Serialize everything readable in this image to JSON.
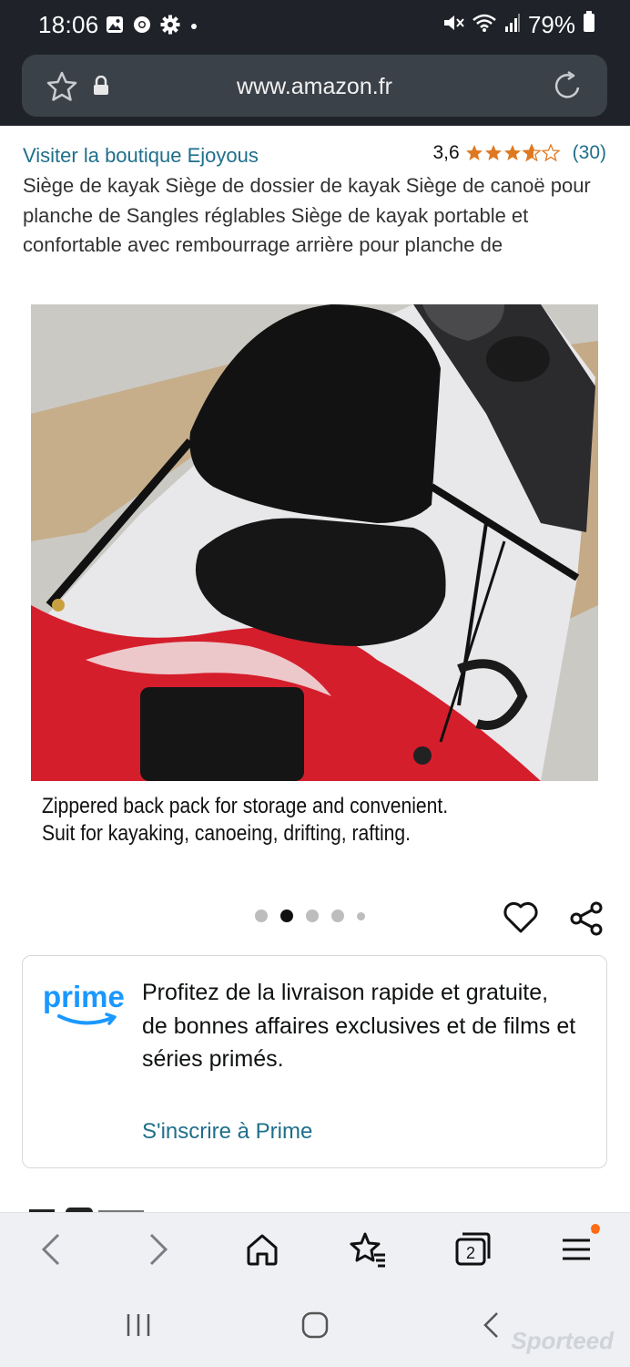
{
  "status_bar": {
    "time": "18:06",
    "battery": "79%",
    "icons": [
      "gallery-icon",
      "chrome-icon",
      "settings-icon",
      "dot-icon",
      "mute-icon",
      "wifi-icon",
      "signal-icon",
      "battery-icon"
    ]
  },
  "browser": {
    "url": "www.amazon.fr",
    "icons": [
      "bookmark-star-icon",
      "lock-icon",
      "reload-icon"
    ]
  },
  "product": {
    "store_link": "Visiter la boutique Ejoyous",
    "rating_value": "3,6",
    "rating_stars": 3.6,
    "rating_count": "(30)",
    "title": "Siège de kayak Siège de dossier de kayak Siège de canoë pour planche de Sangles réglables Siège de kayak portable et confortable avec rembourrage arrière pour planche de",
    "image_caption_line1": "Zippered back pack for storage and convenient.",
    "image_caption_line2": "Suit for kayaking, canoeing, drifting, rafting.",
    "carousel": {
      "total": 5,
      "active": 2
    }
  },
  "prime": {
    "logo": "prime",
    "text": "Profitez de la livraison rapide et gratuite, de bonnes affaires exclusives et de films et séries primés.",
    "link": "S'inscrire à Prime"
  },
  "toolbar": {
    "tabs_count": "2",
    "icons": [
      "back-icon",
      "forward-icon",
      "home-icon",
      "bookmarks-icon",
      "tabs-icon",
      "menu-icon"
    ]
  },
  "system_nav": {
    "icons": [
      "recents-icon",
      "home-button-icon",
      "back-nav-icon"
    ],
    "watermark": "Sporteed"
  },
  "colors": {
    "link": "#1f6f8b",
    "star": "#de7921",
    "prime_blue": "#1a98ff",
    "notification_dot": "#ff6a13"
  }
}
